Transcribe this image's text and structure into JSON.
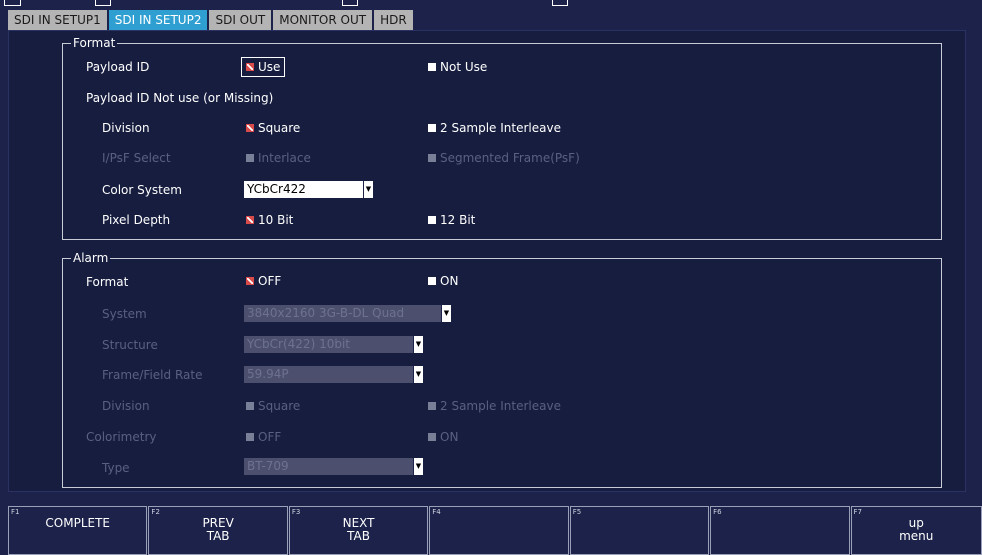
{
  "tabs": [
    "SDI IN SETUP1",
    "SDI IN SETUP2",
    "SDI OUT",
    "MONITOR OUT",
    "HDR"
  ],
  "active_tab": "SDI IN SETUP2",
  "format": {
    "legend": "Format",
    "payload_id": {
      "label": "Payload ID",
      "opt1": "Use",
      "opt2": "Not Use",
      "selected": "Use"
    },
    "missing_label": "Payload ID Not use (or Missing)",
    "division": {
      "label": "Division",
      "opt1": "Square",
      "opt2": "2 Sample Interleave",
      "selected": "Square"
    },
    "ipsf": {
      "label": "I/PsF Select",
      "opt1": "Interlace",
      "opt2": "Segmented Frame(PsF)",
      "disabled": true
    },
    "color_system": {
      "label": "Color System",
      "value": "YCbCr422"
    },
    "pixel_depth": {
      "label": "Pixel Depth",
      "opt1": "10 Bit",
      "opt2": "12 Bit",
      "selected": "10 Bit"
    }
  },
  "alarm": {
    "legend": "Alarm",
    "format": {
      "label": "Format",
      "opt1": "OFF",
      "opt2": "ON",
      "selected": "OFF"
    },
    "system": {
      "label": "System",
      "value": "3840x2160 3G-B-DL Quad",
      "disabled": true
    },
    "structure": {
      "label": "Structure",
      "value": "YCbCr(422) 10bit",
      "disabled": true
    },
    "frame_rate": {
      "label": "Frame/Field Rate",
      "value": "59.94P",
      "disabled": true
    },
    "division": {
      "label": "Division",
      "opt1": "Square",
      "opt2": "2 Sample Interleave",
      "disabled": true
    },
    "colorimetry": {
      "label": "Colorimetry",
      "opt1": "OFF",
      "opt2": "ON",
      "disabled": true
    },
    "type": {
      "label": "Type",
      "value": "BT-709",
      "disabled": true
    }
  },
  "function_keys": [
    {
      "num": "F1",
      "label": "COMPLETE"
    },
    {
      "num": "F2",
      "label": "PREV\nTAB"
    },
    {
      "num": "F3",
      "label": "NEXT\nTAB"
    },
    {
      "num": "F4",
      "label": ""
    },
    {
      "num": "F5",
      "label": ""
    },
    {
      "num": "F6",
      "label": ""
    },
    {
      "num": "F7",
      "label": "up\nmenu"
    }
  ],
  "colors": {
    "background": "#1c2249",
    "active_tab": "#2f9fd2",
    "checked": "#d94a4a"
  }
}
